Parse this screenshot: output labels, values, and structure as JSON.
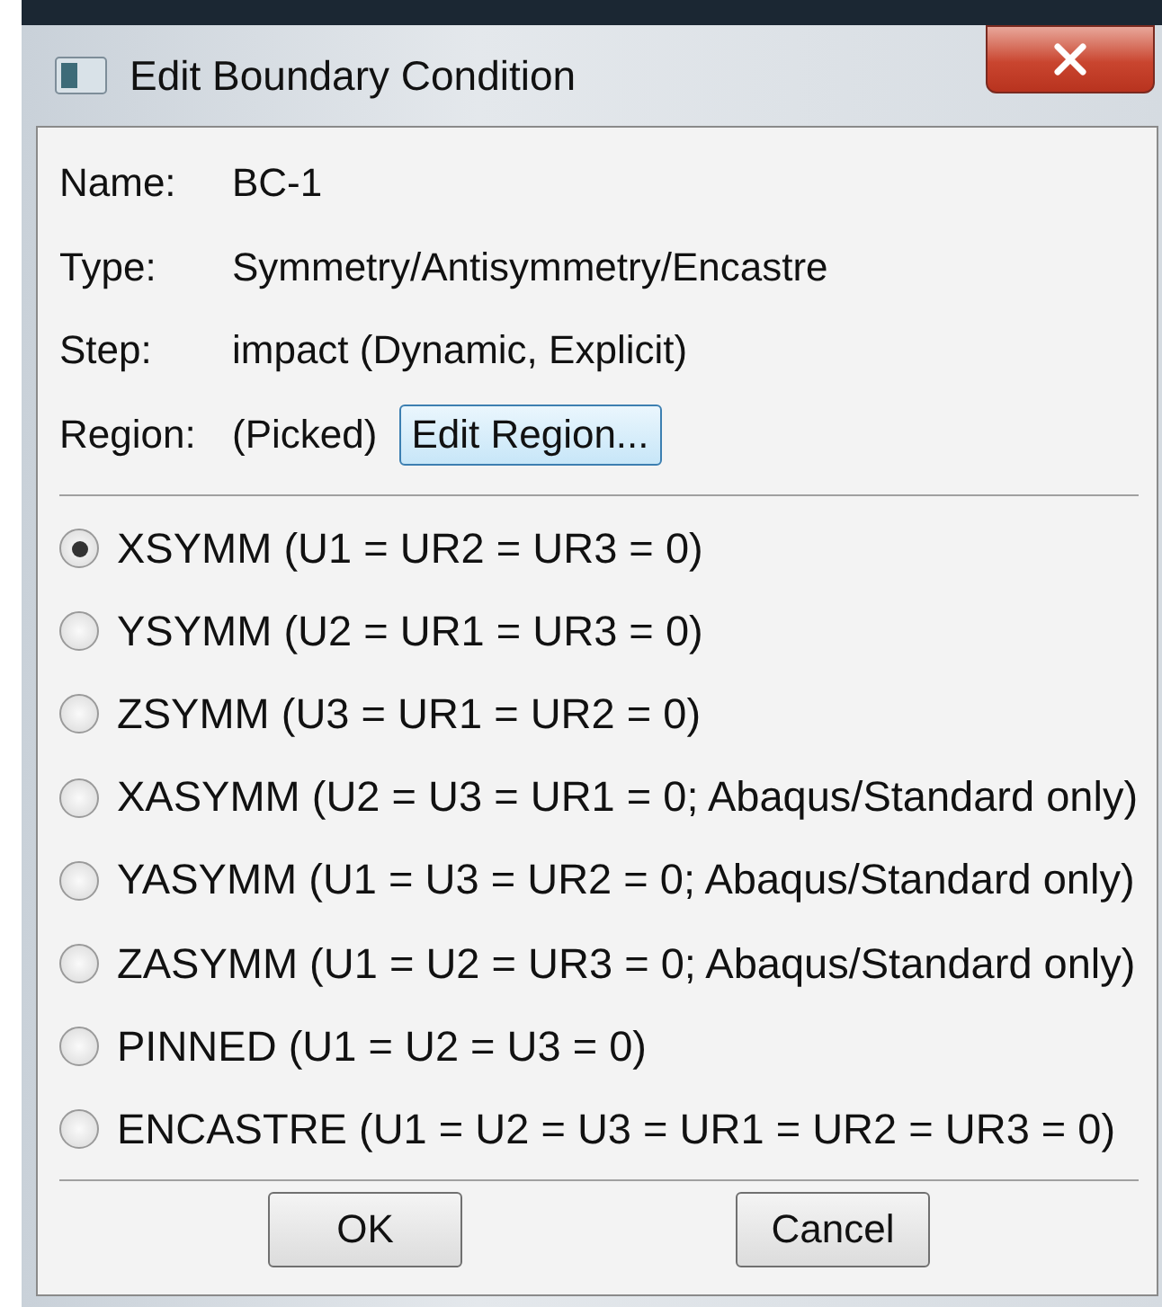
{
  "window": {
    "title": "Edit Boundary Condition"
  },
  "fields": [
    {
      "label": "Name:",
      "value": "BC-1"
    },
    {
      "label": "Type:",
      "value": "Symmetry/Antisymmetry/Encastre"
    },
    {
      "label": "Step:",
      "value": "impact (Dynamic, Explicit)"
    }
  ],
  "region": {
    "label": "Region:",
    "value": "(Picked)",
    "button": "Edit Region..."
  },
  "options": [
    {
      "label": "XSYMM (U1 = UR2 = UR3 = 0)",
      "selected": true
    },
    {
      "label": "YSYMM (U2 = UR1 = UR3 = 0)",
      "selected": false
    },
    {
      "label": "ZSYMM (U3 = UR1 = UR2 = 0)",
      "selected": false
    },
    {
      "label": "XASYMM (U2 = U3 = UR1 = 0; Abaqus/Standard only)",
      "selected": false
    },
    {
      "label": "YASYMM (U1 = U3 = UR2 = 0; Abaqus/Standard only)",
      "selected": false
    },
    {
      "label": "ZASYMM (U1 = U2 = UR3 = 0; Abaqus/Standard only)",
      "selected": false
    },
    {
      "label": "PINNED (U1 = U2 = U3 = 0)",
      "selected": false
    },
    {
      "label": "ENCASTRE (U1 = U2 = U3 = UR1 = UR2 = UR3 = 0)",
      "selected": false
    }
  ],
  "buttons": [
    "OK",
    "Cancel"
  ]
}
